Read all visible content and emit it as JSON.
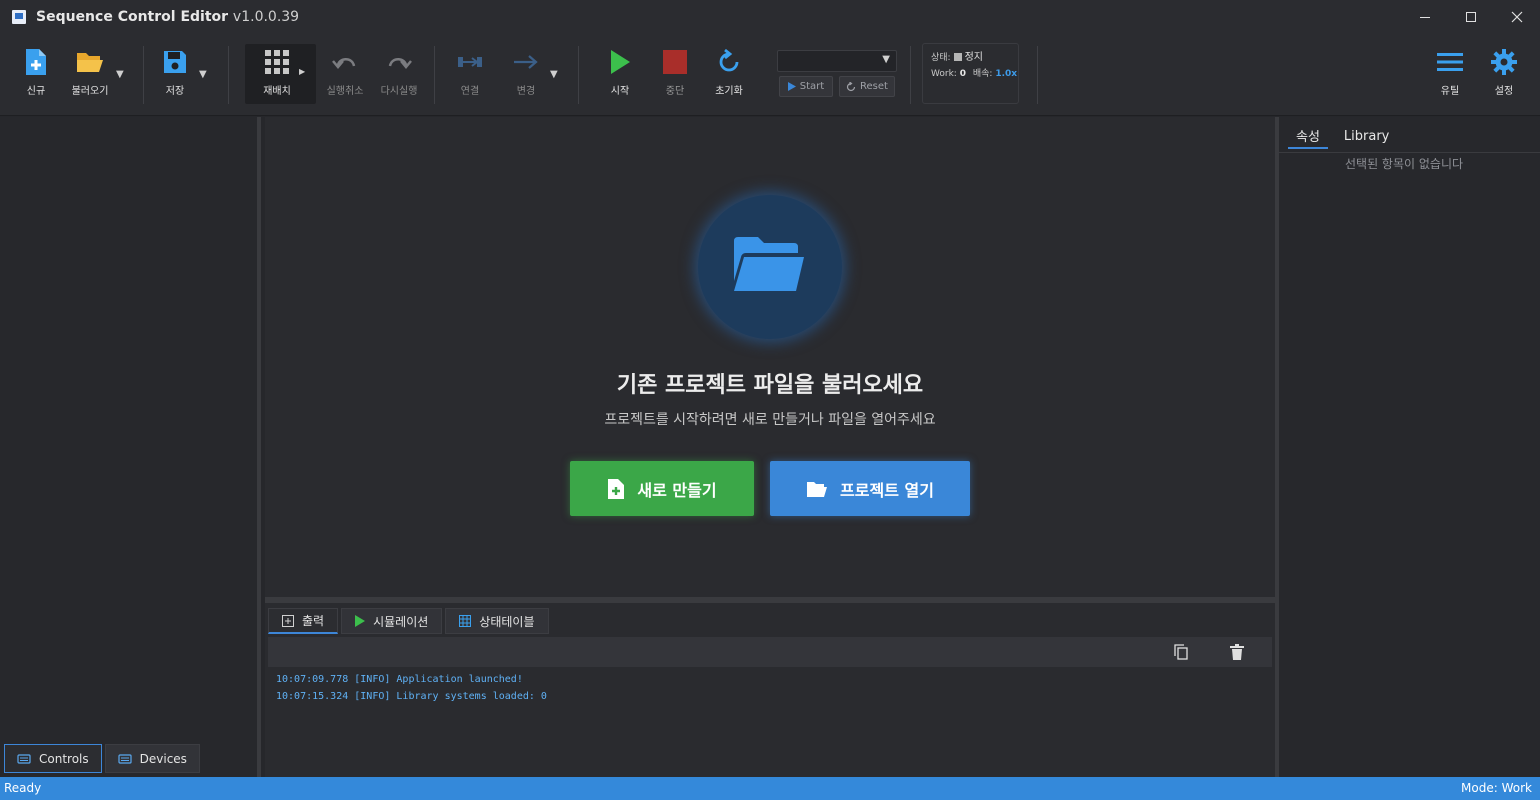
{
  "window": {
    "title": "Sequence Control Editor",
    "version": "v1.0.0.39"
  },
  "toolbar": {
    "new_label": "신규",
    "load_label": "불러오기",
    "save_label": "저장",
    "rearrange_label": "재배치",
    "undo_label": "실행취소",
    "redo_label": "다시실행",
    "connect_label": "연결",
    "change_label": "변경",
    "start_label": "시작",
    "stop_label": "중단",
    "reset_label": "초기화",
    "sequence_select_value": "",
    "small_start_label": "Start",
    "small_reset_label": "Reset",
    "status": {
      "state_label": "상태:",
      "state_value": "정지",
      "work_label": "Work:",
      "work_value": "0",
      "speed_label": "배속:",
      "speed_value": "1.0x"
    },
    "util_label": "유틸",
    "settings_label": "설정"
  },
  "left_panel": {
    "tabs": [
      {
        "label": "Controls",
        "active": true
      },
      {
        "label": "Devices",
        "active": false
      }
    ]
  },
  "welcome": {
    "heading": "기존 프로젝트 파일을 불러오세요",
    "subheading": "프로젝트를 시작하려면 새로 만들거나 파일을 열어주세요",
    "new_button": "새로 만들기",
    "open_button": "프로젝트 열기"
  },
  "bottom_panel": {
    "tabs": [
      {
        "label": "출력",
        "active": true
      },
      {
        "label": "시뮬레이션",
        "active": false
      },
      {
        "label": "상태테이블",
        "active": false
      }
    ],
    "log": [
      "10:07:09.778 [INFO] Application launched!",
      "10:07:15.324 [INFO] Library systems loaded: 0"
    ]
  },
  "right_panel": {
    "tabs": [
      {
        "label": "속성",
        "active": true
      },
      {
        "label": "Library",
        "active": false
      }
    ],
    "empty_text": "선택된 항목이 없습니다"
  },
  "statusbar": {
    "left": "Ready",
    "right": "Mode: Work"
  },
  "colors": {
    "accent": "#3489da",
    "green": "#3ba748",
    "stop_red": "#c0392b",
    "log_text": "#5fb1f5"
  }
}
